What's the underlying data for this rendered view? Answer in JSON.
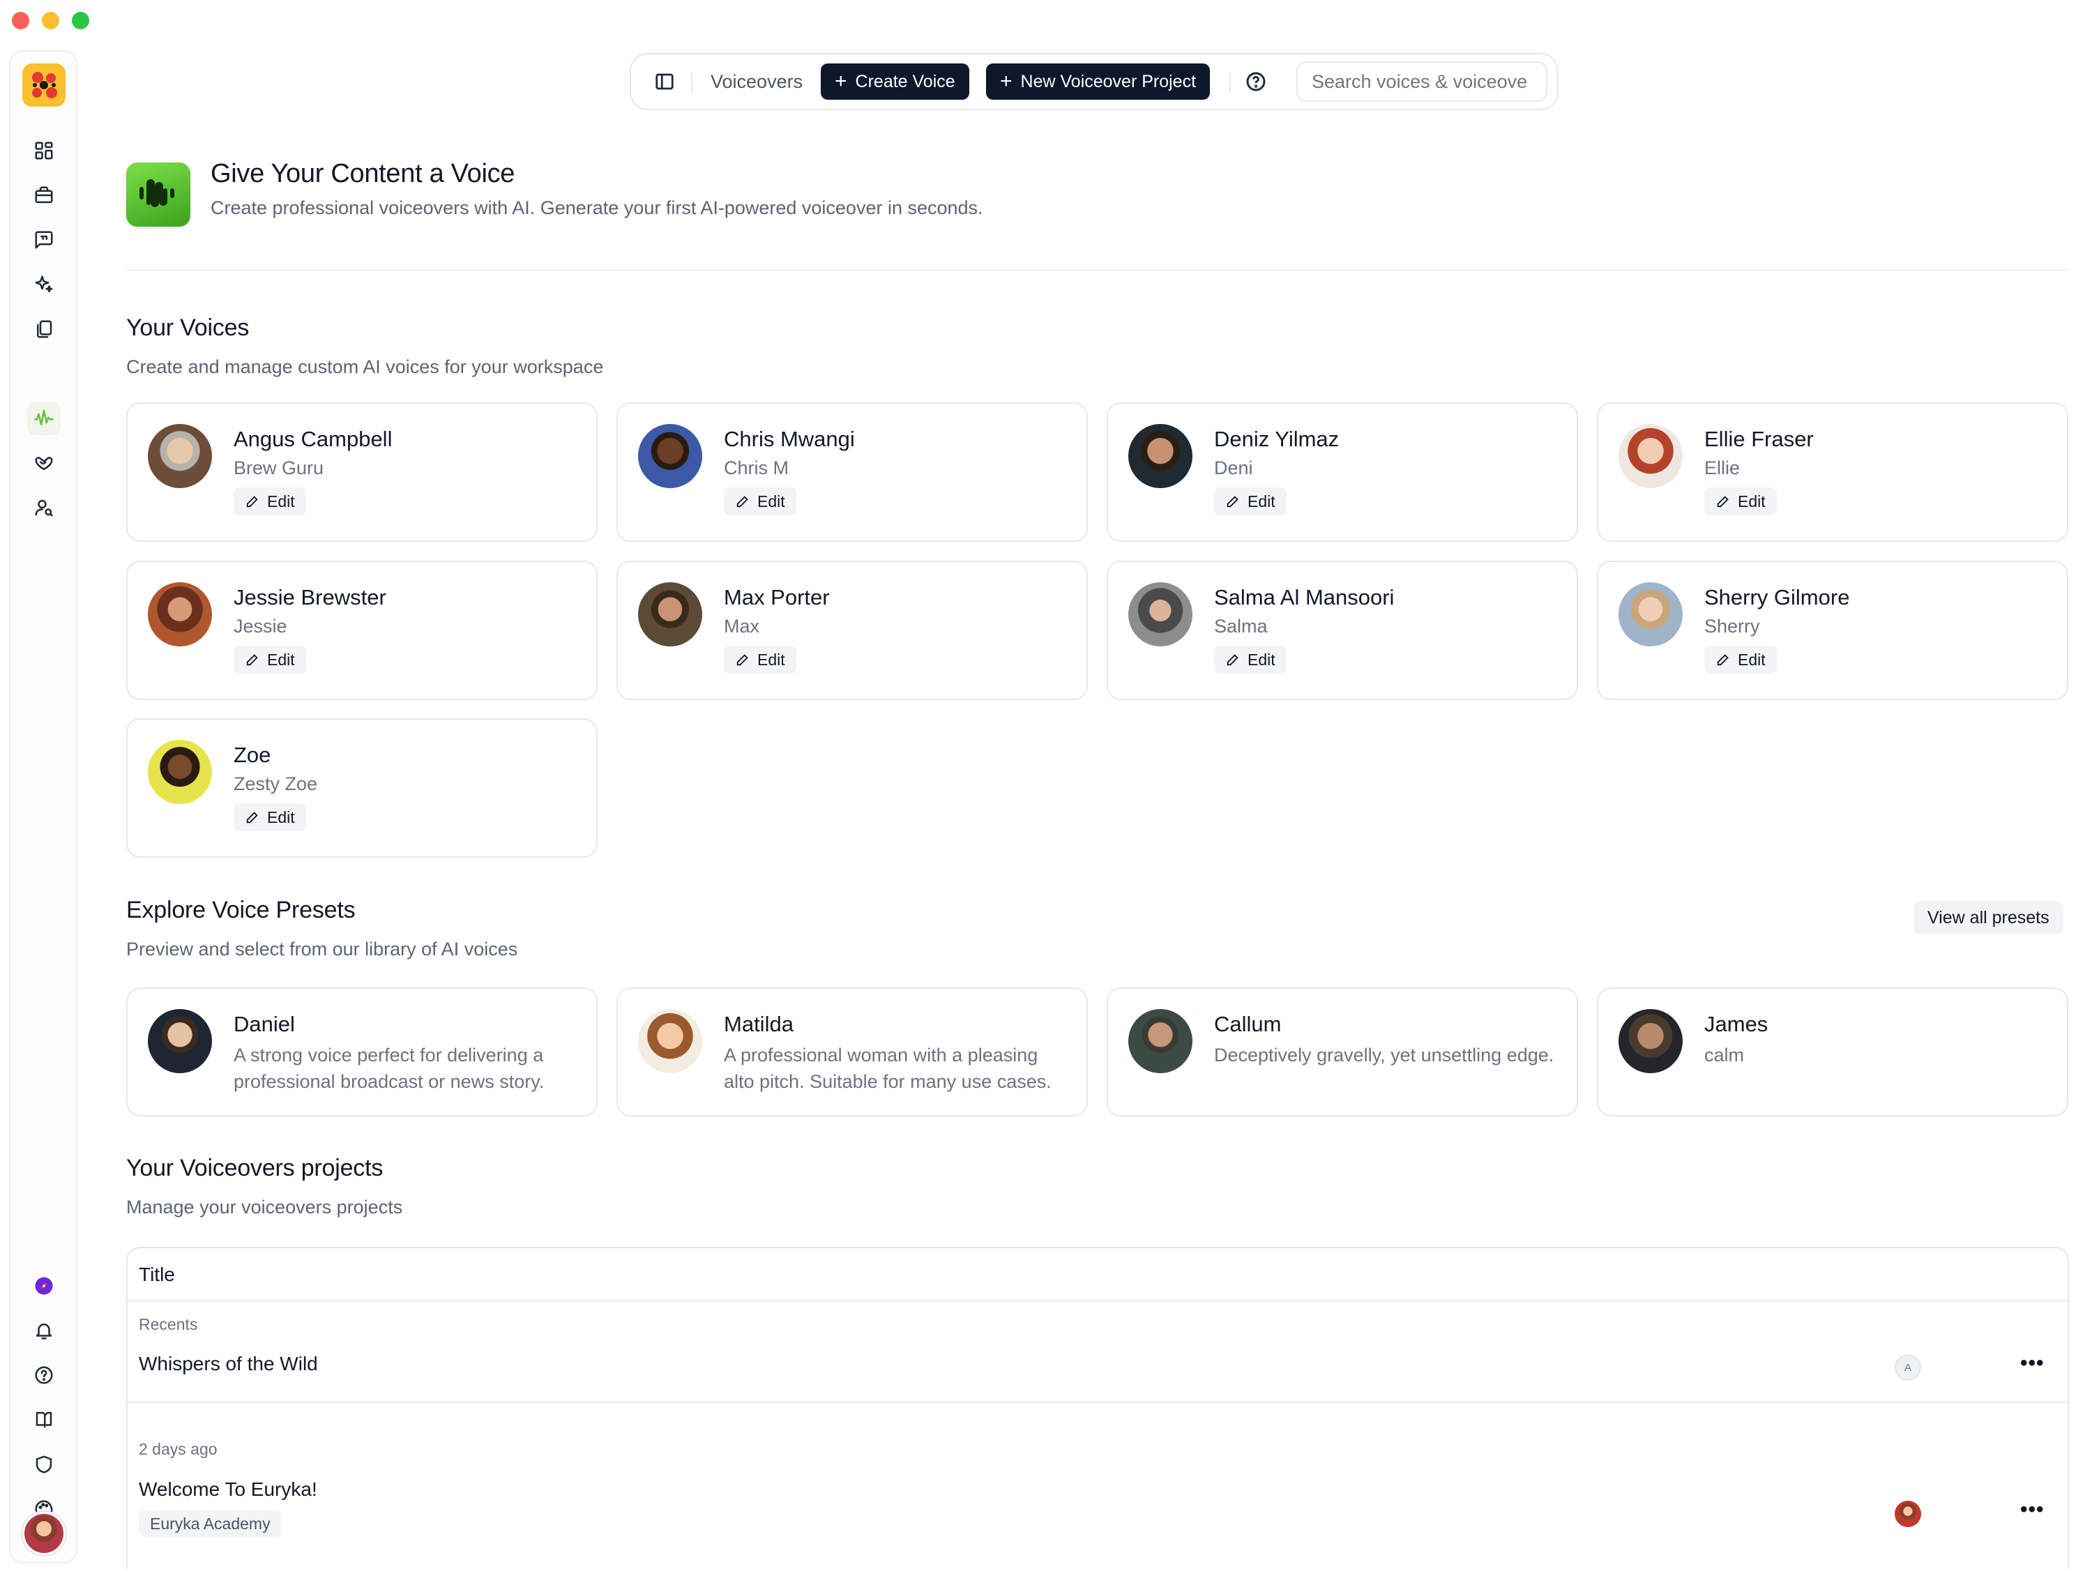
{
  "sidebar": {
    "logo": "euryka-logo",
    "top_icons": [
      "layout-grid-icon",
      "briefcase-icon",
      "message-square-icon",
      "sparkles-icon",
      "documents-icon",
      "audio-waveform-icon",
      "heart-handshake-icon",
      "user-search-icon"
    ],
    "active_icon": "audio-waveform-icon",
    "bottom_icons": [
      "compass-icon",
      "bell-icon",
      "help-circle-icon",
      "book-icon",
      "shield-icon",
      "palette-icon"
    ],
    "accent_color": "#6bbf3a"
  },
  "toolbar": {
    "section_label": "Voiceovers",
    "create_voice_label": "Create Voice",
    "new_project_label": "New Voiceover Project",
    "search_placeholder": "Search voices & voiceove"
  },
  "hero": {
    "title": "Give Your Content a Voice",
    "subtitle": "Create professional voiceovers with AI. Generate your first AI-powered voiceover in seconds."
  },
  "your_voices": {
    "title": "Your Voices",
    "subtitle": "Create and manage custom AI voices for your workspace",
    "edit_label": "Edit",
    "items": [
      {
        "name": "Angus Campbell",
        "short": "Brew Guru"
      },
      {
        "name": "Chris Mwangi",
        "short": "Chris M"
      },
      {
        "name": "Deniz Yilmaz",
        "short": "Deni"
      },
      {
        "name": "Ellie Fraser",
        "short": "Ellie"
      },
      {
        "name": "Jessie Brewster",
        "short": "Jessie"
      },
      {
        "name": "Max Porter",
        "short": "Max"
      },
      {
        "name": "Salma Al Mansoori",
        "short": "Salma"
      },
      {
        "name": "Sherry Gilmore",
        "short": "Sherry"
      },
      {
        "name": "Zoe",
        "short": "Zesty Zoe"
      }
    ]
  },
  "presets": {
    "title": "Explore Voice Presets",
    "subtitle": "Preview and select from our library of AI voices",
    "view_all_label": "View all presets",
    "items": [
      {
        "name": "Daniel",
        "description": "A strong voice perfect for delivering a professional broadcast or news story."
      },
      {
        "name": "Matilda",
        "description": "A professional woman with a pleasing alto pitch. Suitable for many use cases."
      },
      {
        "name": "Callum",
        "description": "Deceptively gravelly, yet unsettling edge."
      },
      {
        "name": "James",
        "description": "calm"
      }
    ]
  },
  "projects": {
    "title": "Your Voiceovers projects",
    "subtitle": "Manage your voiceovers projects",
    "column_title": "Title",
    "groups": [
      {
        "label": "Recents",
        "rows": [
          {
            "title": "Whispers of the Wild",
            "tag": "",
            "owner_initial": "A"
          }
        ]
      },
      {
        "label": "2 days ago",
        "rows": [
          {
            "title": "Welcome To Euryka!",
            "tag": "Euryka Academy",
            "owner_initial": ""
          }
        ]
      }
    ],
    "more_label": "•••"
  }
}
